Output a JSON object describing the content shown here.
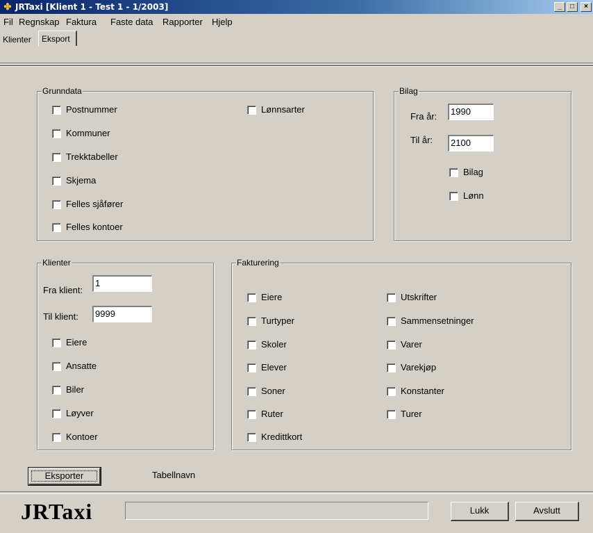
{
  "window": {
    "title": "JRTaxi [Klient 1 - Test 1 - 1/2003]",
    "icon": "taxi-app-icon",
    "controls": {
      "minimize": "_",
      "maximize": "□",
      "close": "×"
    }
  },
  "menu": [
    "Fil",
    "Regnskap",
    "Faktura",
    "Faste data",
    "Rapporter",
    "Hjelp"
  ],
  "tabs": [
    {
      "label": "Klienter",
      "selected": false
    },
    {
      "label": "Eksport",
      "selected": true
    }
  ],
  "grunndata": {
    "title": "Grunndata",
    "items": [
      "Postnummer",
      "Kommuner",
      "Trekktabeller",
      "Skjema",
      "Felles sjåfører",
      "Felles kontoer"
    ],
    "right_items": [
      "Lønnsarter"
    ]
  },
  "bilag": {
    "title": "Bilag",
    "fra_label": "Fra år:",
    "fra_value": "1990",
    "til_label": "Til år:",
    "til_value": "2100",
    "items": [
      "Bilag",
      "Lønn"
    ]
  },
  "klienter": {
    "title": "Klienter",
    "fra_label": "Fra klient:",
    "fra_value": "1",
    "til_label": "Til klient:",
    "til_value": "9999",
    "items": [
      "Eiere",
      "Ansatte",
      "Biler",
      "Løyver",
      "Kontoer"
    ]
  },
  "fakturering": {
    "title": "Fakturering",
    "left": [
      "Eiere",
      "Turtyper",
      "Skoler",
      "Elever",
      "Soner",
      "Ruter",
      "Kredittkort"
    ],
    "right": [
      "Utskrifter",
      "Sammensetninger",
      "Varer",
      "Varekjøp",
      "Konstanter",
      "Turer"
    ]
  },
  "actions": {
    "export": "Eksporter",
    "table_name_label": "Tabellnavn"
  },
  "footer": {
    "logo": "JRTaxi",
    "status_text": "",
    "close": "Lukk",
    "exit": "Avslutt"
  }
}
